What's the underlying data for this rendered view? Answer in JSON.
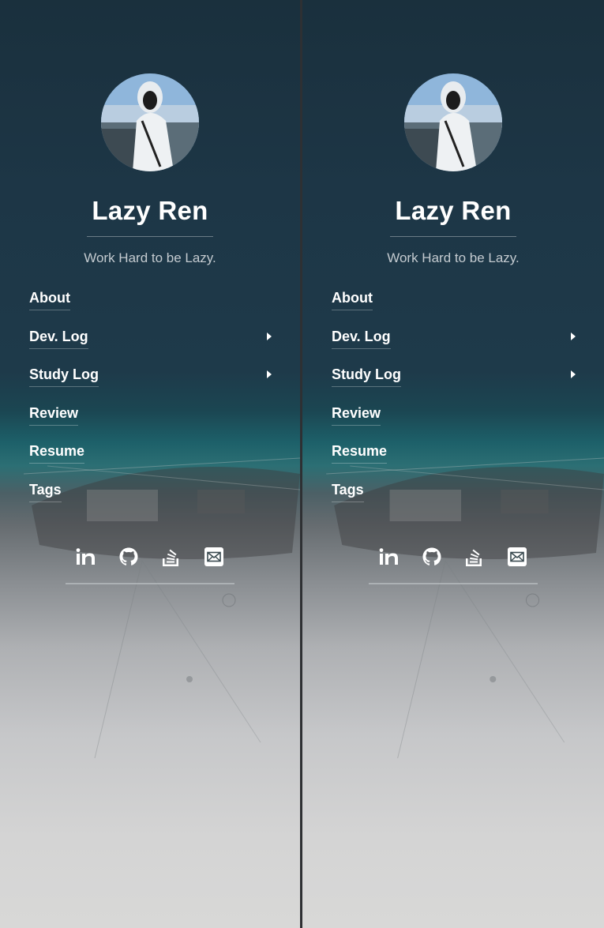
{
  "colors": {
    "accent": "#ffffff",
    "top_background": "#1d3646",
    "bottom_background": "#d6d6d5"
  },
  "panels": [
    {
      "name": "Lazy Ren",
      "tagline": "Work Hard to be Lazy.",
      "nav": [
        {
          "label": "About",
          "has_submenu": false
        },
        {
          "label": "Dev. Log",
          "has_submenu": true
        },
        {
          "label": "Study Log",
          "has_submenu": true
        },
        {
          "label": "Review",
          "has_submenu": false
        },
        {
          "label": "Resume",
          "has_submenu": false
        },
        {
          "label": "Tags",
          "has_submenu": false
        }
      ],
      "socials": [
        "linkedin-icon",
        "github-icon",
        "stackoverflow-icon",
        "email-icon"
      ]
    },
    {
      "name": "Lazy Ren",
      "tagline": "Work Hard to be Lazy.",
      "nav": [
        {
          "label": "About",
          "has_submenu": false
        },
        {
          "label": "Dev. Log",
          "has_submenu": true
        },
        {
          "label": "Study Log",
          "has_submenu": true
        },
        {
          "label": "Review",
          "has_submenu": false
        },
        {
          "label": "Resume",
          "has_submenu": false
        },
        {
          "label": "Tags",
          "has_submenu": false
        }
      ],
      "socials": [
        "linkedin-icon",
        "github-icon",
        "stackoverflow-icon",
        "email-icon"
      ]
    }
  ]
}
